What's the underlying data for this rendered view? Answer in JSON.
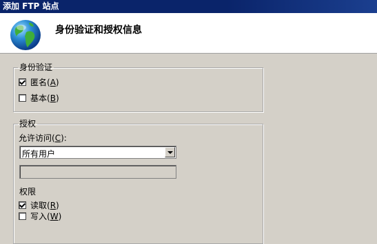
{
  "window": {
    "title": "添加 FTP 站点"
  },
  "header": {
    "title": "身份验证和授权信息"
  },
  "auth": {
    "legend": "身份验证",
    "anonymous": {
      "label": "匿名",
      "key": "A",
      "checked": true
    },
    "basic": {
      "label": "基本",
      "key": "B",
      "checked": false
    }
  },
  "authz": {
    "legend": "授权",
    "allow_label": "允许访问",
    "allow_key": "C",
    "allow_suffix": ":",
    "allow_value": "所有用户",
    "textbox_value": "",
    "permissions_label": "权限",
    "read": {
      "label": "读取",
      "key": "R",
      "checked": true
    },
    "write": {
      "label": "写入",
      "key": "W",
      "checked": false
    }
  }
}
